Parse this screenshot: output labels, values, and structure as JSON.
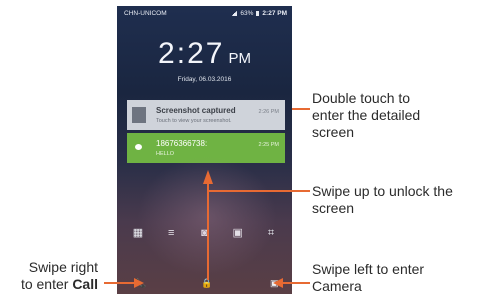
{
  "status_bar": {
    "carrier": "CHN-UNICOM",
    "battery": "63%",
    "time": "2:27 PM"
  },
  "clock": {
    "time": "2:27",
    "ampm": "PM",
    "date": "Friday, 06.03.2016"
  },
  "notifications": [
    {
      "title": "Screenshot captured",
      "subtitle": "Touch to view your screenshot.",
      "time": "2:26 PM"
    },
    {
      "title": "18676366738:",
      "subtitle": "HELLO",
      "time": "2:25 PM"
    }
  ],
  "shortcuts": [
    {
      "icon": "calculator-icon",
      "glyph": "▦"
    },
    {
      "icon": "notes-icon",
      "glyph": "≡"
    },
    {
      "icon": "camera-icon",
      "glyph": "◙"
    },
    {
      "icon": "contacts-icon",
      "glyph": "▣"
    },
    {
      "icon": "scanner-icon",
      "glyph": "⌗"
    }
  ],
  "bottom_icons": {
    "phone": "📞",
    "lock": "🔒",
    "camera": "▣"
  },
  "annotations": {
    "double_touch": [
      "Double touch to",
      "enter the detailed",
      "screen"
    ],
    "swipe_up": [
      "Swipe up to unlock the",
      "screen"
    ],
    "swipe_right": [
      "Swipe right",
      "to enter "
    ],
    "swipe_right_bold": "Call",
    "swipe_left": [
      "Swipe left to enter",
      "Camera"
    ]
  },
  "colors": {
    "accent_orange": "#e76a33",
    "notif_green": "#6fb343"
  }
}
